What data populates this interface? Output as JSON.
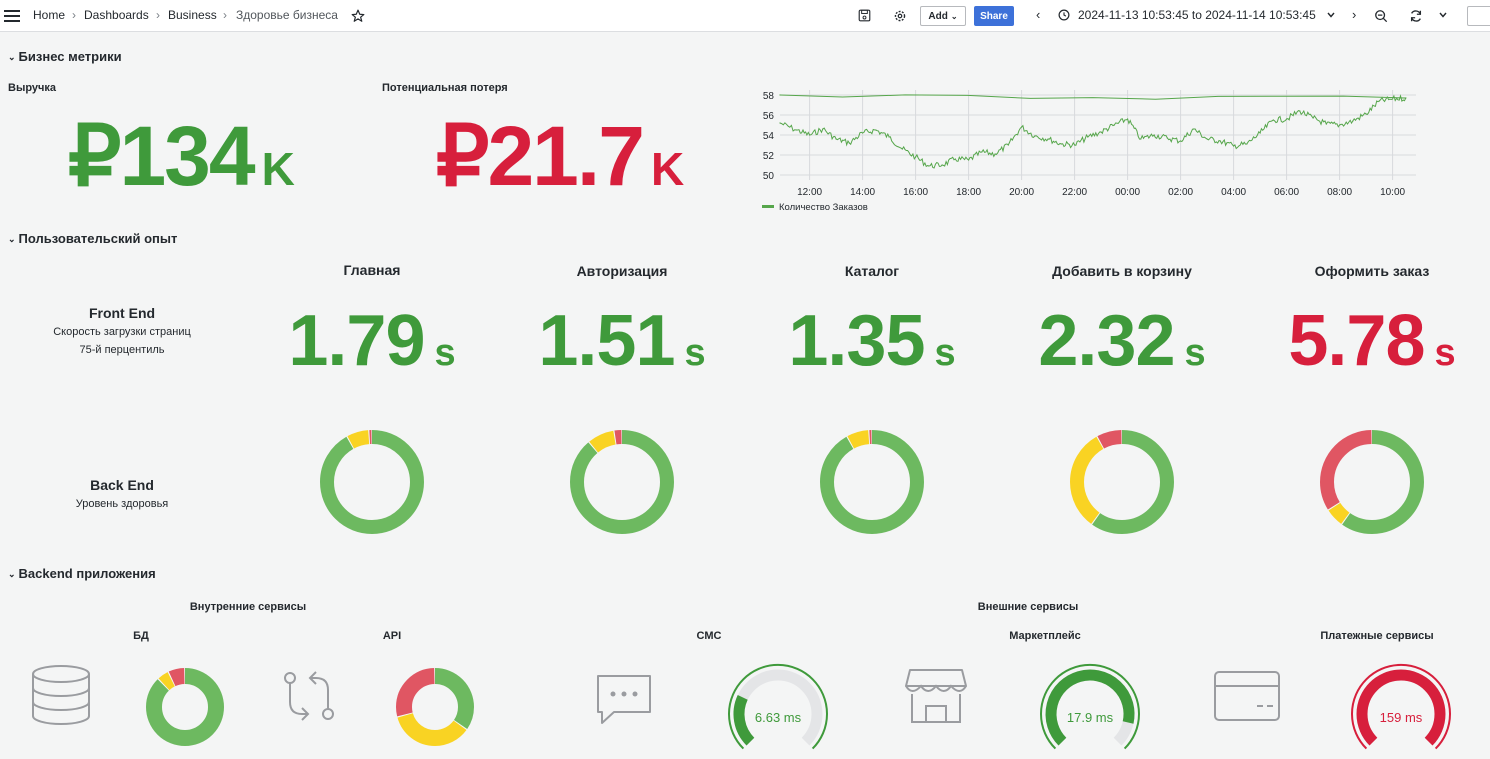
{
  "topbar": {
    "breadcrumbs": [
      "Home",
      "Dashboards",
      "Business",
      "Здоровье бизнеса"
    ],
    "add_label": "Add",
    "share_label": "Share",
    "time_range": "2024-11-13 10:53:45 to 2024-11-14 10:53:45"
  },
  "sections": {
    "business": "Бизнес метрики",
    "ux": "Пользовательский опыт",
    "backend": "Backend приложения"
  },
  "business": {
    "revenue": {
      "title": "Выручка",
      "value": "₽134",
      "unit": "K"
    },
    "loss": {
      "title": "Потенциальная потеря",
      "value": "₽21.7",
      "unit": "K"
    }
  },
  "chart_data": {
    "type": "line",
    "title": "",
    "x_ticks": [
      "12:00",
      "14:00",
      "16:00",
      "18:00",
      "20:00",
      "22:00",
      "00:00",
      "02:00",
      "04:00",
      "06:00",
      "08:00",
      "10:00"
    ],
    "y_ticks": [
      50,
      52,
      54,
      56,
      58
    ],
    "ylim": [
      49.5,
      58.5
    ],
    "grid": true,
    "legend_position": "bottom-left",
    "series": [
      {
        "name": "Количество Заказов",
        "color": "#56a64b",
        "x": [
          "10:53",
          "11:30",
          "12:00",
          "12:30",
          "13:00",
          "13:30",
          "14:00",
          "14:30",
          "15:00",
          "15:30",
          "16:00",
          "16:30",
          "17:00",
          "17:30",
          "18:00",
          "18:30",
          "19:00",
          "19:30",
          "20:00",
          "20:30",
          "21:00",
          "21:30",
          "22:00",
          "22:30",
          "23:00",
          "23:30",
          "00:00",
          "00:30",
          "01:00",
          "01:30",
          "02:00",
          "02:30",
          "03:00",
          "03:30",
          "04:00",
          "04:30",
          "05:00",
          "05:30",
          "06:00",
          "06:30",
          "07:00",
          "07:30",
          "08:00",
          "08:30",
          "09:00",
          "09:30",
          "10:00",
          "10:30",
          "10:53"
        ],
        "values": [
          55.2,
          54.5,
          54.0,
          54.6,
          53.6,
          53.2,
          54.2,
          54.5,
          53.8,
          52.6,
          51.8,
          50.9,
          51.0,
          51.6,
          51.5,
          52.3,
          52.1,
          53.0,
          54.8,
          53.9,
          53.6,
          53.1,
          53.0,
          53.8,
          54.3,
          55.0,
          55.6,
          53.6,
          54.0,
          53.7,
          53.4,
          54.6,
          53.6,
          53.4,
          52.9,
          53.1,
          54.2,
          55.5,
          55.6,
          56.4,
          55.7,
          55.1,
          55.0,
          55.4,
          56.1,
          57.4,
          57.6,
          57.7,
          58.0
        ]
      }
    ]
  },
  "ux": {
    "frontend": {
      "title": "Front End",
      "sub1": "Скорость загрузки страниц",
      "sub2": "75-й перцентиль"
    },
    "backend": {
      "title": "Back End",
      "sub1": "Уровень здоровья"
    },
    "pages": [
      {
        "title": "Главная",
        "value": "1.79",
        "unit": "s",
        "status": "green",
        "health": {
          "ok": 92,
          "warn": 7,
          "err": 1
        }
      },
      {
        "title": "Авторизация",
        "value": "1.51",
        "unit": "s",
        "status": "green",
        "health": {
          "ok": 89,
          "warn": 8.5,
          "err": 2.5
        }
      },
      {
        "title": "Каталог",
        "value": "1.35",
        "unit": "s",
        "status": "green",
        "health": {
          "ok": 92,
          "warn": 7,
          "err": 1
        }
      },
      {
        "title": "Добавить в корзину",
        "value": "2.32",
        "unit": "s",
        "status": "green",
        "health": {
          "ok": 60,
          "warn": 32,
          "err": 8
        }
      },
      {
        "title": "Оформить заказ",
        "value": "5.78",
        "unit": "s",
        "status": "red",
        "health": {
          "ok": 60,
          "warn": 6,
          "err": 34
        }
      }
    ]
  },
  "backend": {
    "internal_label": "Внутренние сервисы",
    "external_label": "Внешние сервисы",
    "db": {
      "title": "БД",
      "icon": "database-icon",
      "health": {
        "ok": 88,
        "warn": 5,
        "err": 7
      }
    },
    "api": {
      "title": "API",
      "icon": "api-icon",
      "health": {
        "ok": 35,
        "warn": 36,
        "err": 29
      }
    },
    "sms": {
      "title": "СМС",
      "icon": "message-icon",
      "value": "6.63 ms",
      "fraction": 0.26,
      "color": "#3f9a3b"
    },
    "marketplace": {
      "title": "Маркетплейс",
      "icon": "store-icon",
      "value": "17.9 ms",
      "fraction": 0.88,
      "color": "#3f9a3b"
    },
    "payments": {
      "title": "Платежные сервисы",
      "icon": "credit-card-icon",
      "value": "159 ms",
      "fraction": 1.0,
      "color": "#d71f3c"
    }
  },
  "colors": {
    "ok": "#6db960",
    "warn": "#f9d323",
    "err": "#e05663"
  }
}
